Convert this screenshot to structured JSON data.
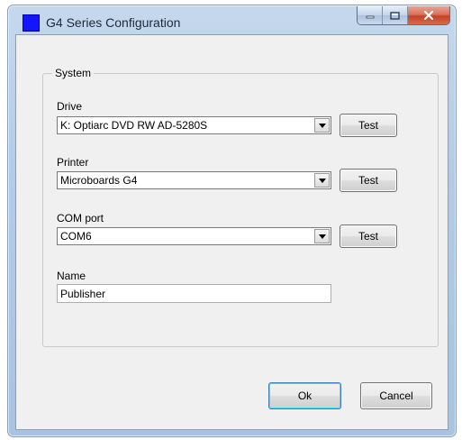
{
  "window": {
    "title": "G4 Series Configuration",
    "icon": "app-icon",
    "caption_buttons": [
      "minimize-icon",
      "maximize-icon",
      "close-icon"
    ]
  },
  "system_group": {
    "label": "System",
    "drive": {
      "label": "Drive",
      "value": "K: Optiarc DVD RW AD-5280S",
      "test_label": "Test"
    },
    "printer": {
      "label": "Printer",
      "value": "Microboards G4",
      "test_label": "Test"
    },
    "com_port": {
      "label": "COM port",
      "value": "COM6",
      "test_label": "Test"
    },
    "name": {
      "label": "Name",
      "value": "Publisher"
    }
  },
  "buttons": {
    "ok": "Ok",
    "cancel": "Cancel"
  },
  "colors": {
    "app_icon": "#1414ff",
    "frame": "#b3cbe6",
    "client_bg": "#f0f0f0",
    "close_button": "#c4432a"
  }
}
